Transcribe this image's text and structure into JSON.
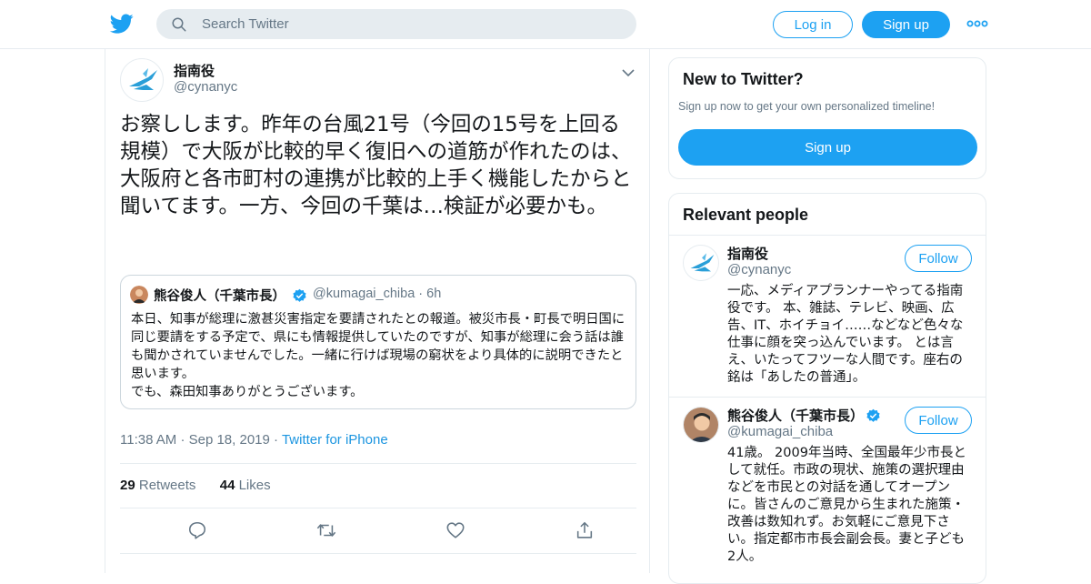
{
  "colors": {
    "brand": "#1da1f2",
    "link": "#1b95e0",
    "muted": "#657786",
    "border": "#e6ecf0",
    "verified": "#1da1f2"
  },
  "header": {
    "logo_icon": "twitter-bird-icon",
    "search_placeholder": "Search Twitter",
    "login_label": "Log in",
    "signup_label": "Sign up",
    "more_icon": "more-dots-icon"
  },
  "tweet": {
    "author_name": "指南役",
    "author_handle": "@cynanyc",
    "text": "お察しします。昨年の台風21号（今回の15号を上回る規模）で大阪が比較的早く復旧への道筋が作れたのは、大阪府と各市町村の連携が比較的上手く機能したからと聞いてます。一方、今回の千葉は…検証が必要かも。",
    "quote": {
      "author_name": "熊谷俊人（千葉市長）",
      "author_handle": "@kumagai_chiba · 6h",
      "text": "本日、知事が総理に激甚災害指定を要請されたとの報道。被災市長・町長で明日国に同じ要請をする予定で、県にも情報提供していたのですが、知事が総理に会う話は誰も聞かされていませんでした。一緒に行けば現場の窮状をより具体的に説明できたと思います。\nでも、森田知事ありがとうございます。"
    },
    "time": "11:38 AM",
    "date": "Sep 18, 2019",
    "source": "Twitter for iPhone",
    "retweets_count": "29",
    "retweets_label": "Retweets",
    "likes_count": "44",
    "likes_label": "Likes"
  },
  "sidebar": {
    "new_title": "New to Twitter?",
    "new_subtitle": "Sign up now to get your own personalized timeline!",
    "signup_label": "Sign up",
    "relevant_title": "Relevant people",
    "people": [
      {
        "name": "指南役",
        "handle": "@cynanyc",
        "verified": false,
        "follow_label": "Follow",
        "bio": "一応、メディアプランナーやってる指南役です。 本、雑誌、テレビ、映画、広告、IT、ホイチョイ……などなど色々な仕事に顔を突っ込んでいます。 とは言え、いたってフツーな人間です。座右の銘は「あしたの普通」。"
      },
      {
        "name": "熊谷俊人（千葉市長）",
        "handle": "@kumagai_chiba",
        "verified": true,
        "follow_label": "Follow",
        "bio": "41歳。 2009年当時、全国最年少市長として就任。市政の現状、施策の選択理由などを市民との対話を通してオープンに。皆さんのご意見から生まれた施策・改善は数知れず。お気軽にご意見下さい。指定都市市長会副会長。妻と子ども2人。"
      }
    ]
  }
}
